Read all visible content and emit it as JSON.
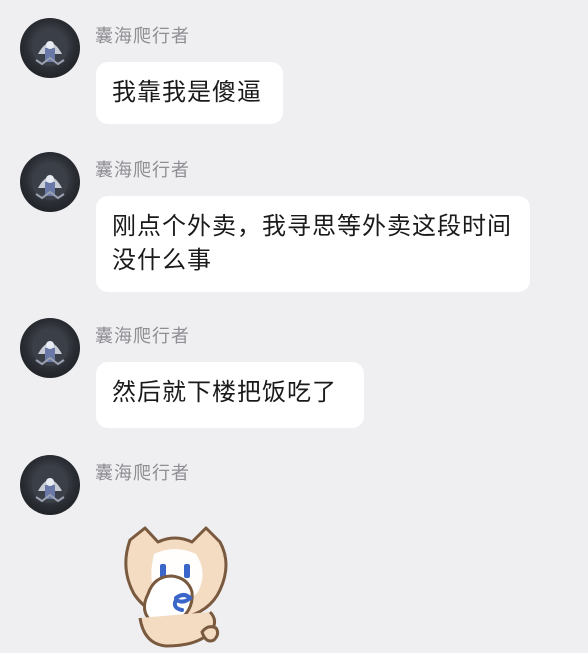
{
  "chat": {
    "messages": [
      {
        "sender": "囊海爬行者",
        "text": "我靠我是傻逼",
        "avatar_icon": "robot-avatar"
      },
      {
        "sender": "囊海爬行者",
        "text": "刚点个外卖，我寻思等外卖这段时间没什么事",
        "avatar_icon": "robot-avatar"
      },
      {
        "sender": "囊海爬行者",
        "text": "然后就下楼把饭吃了",
        "avatar_icon": "robot-avatar"
      },
      {
        "sender": "囊海爬行者",
        "sticker_icon": "cat-covering-face-sticker",
        "avatar_icon": "robot-avatar"
      }
    ]
  },
  "colors": {
    "background": "#efeff1",
    "bubble": "#ffffff",
    "sender_text": "#8e8e93",
    "message_text": "#1a1a1a"
  }
}
